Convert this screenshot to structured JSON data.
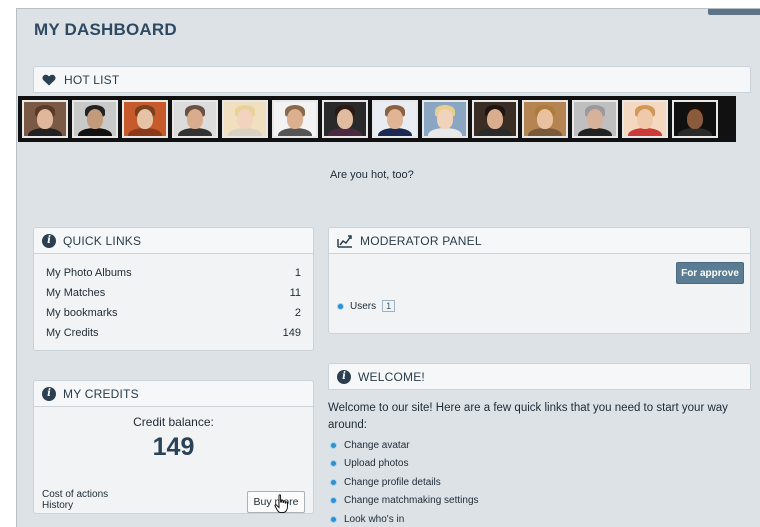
{
  "page": {
    "title": "MY DASHBOARD"
  },
  "hot_list": {
    "title": "HOT LIST",
    "question": "Are you hot, too?",
    "photos": [
      {
        "bg": "#7a5a45",
        "skin": "#e0b79b",
        "hair": "#5a3a26",
        "cloth": "#222"
      },
      {
        "bg": "#c9c9c9",
        "skin": "#c49a7c",
        "hair": "#222",
        "cloth": "#111"
      },
      {
        "bg": "#c65a2a",
        "skin": "#e7c3a5",
        "hair": "#7a3f1d",
        "cloth": "#8a3a1a"
      },
      {
        "bg": "#dcdcdc",
        "skin": "#d8ac8c",
        "hair": "#6a5040",
        "cloth": "#333"
      },
      {
        "bg": "#f0e0c0",
        "skin": "#f2d3bd",
        "hair": "#e8d29a",
        "cloth": "#d9d2c0"
      },
      {
        "bg": "#f3f3f3",
        "skin": "#dcb08e",
        "hair": "#8a6a4a",
        "cloth": "#555"
      },
      {
        "bg": "#2a2a2a",
        "skin": "#e1bba0",
        "hair": "#2a1a12",
        "cloth": "#4a2a40"
      },
      {
        "bg": "#e9edf2",
        "skin": "#e2b496",
        "hair": "#8a6240",
        "cloth": "#1b2a52"
      },
      {
        "bg": "#8aa6c2",
        "skin": "#f1d3bb",
        "hair": "#e7cf90",
        "cloth": "#e8e8e8"
      },
      {
        "bg": "#3a2e24",
        "skin": "#d8ae8e",
        "hair": "#1f140e",
        "cloth": "#2a2a2a"
      },
      {
        "bg": "#b48452",
        "skin": "#eac19e",
        "hair": "#b07a3c",
        "cloth": "#7a5a3a"
      },
      {
        "bg": "#bfbfbf",
        "skin": "#d6b29a",
        "hair": "#9a9a9a",
        "cloth": "#222"
      },
      {
        "bg": "#f4d9c0",
        "skin": "#f0c9aa",
        "hair": "#d29858",
        "cloth": "#cc3a3a"
      },
      {
        "bg": "#101010",
        "skin": "#8a5a3c",
        "hair": "#1a0e08",
        "cloth": "#2a2a2a"
      }
    ]
  },
  "quick_links": {
    "title": "QUICK LINKS",
    "items": [
      {
        "label": "My Photo Albums",
        "count": "1"
      },
      {
        "label": "My Matches",
        "count": "11"
      },
      {
        "label": "My bookmarks",
        "count": "2"
      },
      {
        "label": "My Credits",
        "count": "149"
      }
    ]
  },
  "moderator": {
    "title": "MODERATOR PANEL",
    "approve_label": "For approve",
    "users_label": "Users",
    "users_count": "1"
  },
  "credits": {
    "title": "MY CREDITS",
    "balance_label": "Credit balance:",
    "balance_value": "149",
    "cost_link": "Cost of actions",
    "history_link": "History",
    "buy_label": "Buy more"
  },
  "welcome": {
    "title": "WELCOME!",
    "intro": "Welcome to our site! Here are a few quick links that you need to start your way around:",
    "links": [
      "Change avatar",
      "Upload photos",
      "Change profile details",
      "Change matchmaking settings",
      "Look who's in"
    ]
  },
  "colors": {
    "accent": "#2f8fd1",
    "header": "#2d4a62",
    "button": "#5b7c93"
  }
}
